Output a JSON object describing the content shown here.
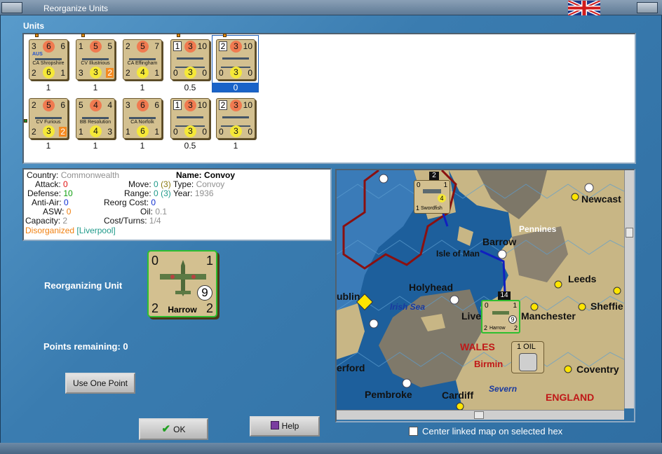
{
  "window": {
    "title": "Reorganize Units"
  },
  "units": {
    "label": "Units",
    "row1": [
      {
        "name": "CA Shropshire",
        "tl": "3",
        "tm": "6",
        "tr": "6",
        "bl": "2",
        "bm": "6",
        "br": "1",
        "sub": "AUS",
        "value": "1"
      },
      {
        "name": "CV Illustrious",
        "tl": "1",
        "tm": "5",
        "tr": "5",
        "bl": "3",
        "bm": "3",
        "br": "2",
        "value": "1"
      },
      {
        "name": "CA Effingham",
        "tl": "2",
        "tm": "5",
        "tr": "7",
        "bl": "2",
        "bm": "4",
        "br": "1",
        "value": "1"
      },
      {
        "name": "",
        "tl": "1",
        "tm": "3",
        "tr": "10",
        "bl": "0",
        "bm": "3",
        "br": "0",
        "value": "0.5"
      },
      {
        "name": "",
        "tl": "2",
        "tm": "3",
        "tr": "10",
        "bl": "0",
        "bm": "3",
        "br": "0",
        "value": "0"
      }
    ],
    "row2": [
      {
        "name": "CV Furious",
        "tl": "2",
        "tm": "5",
        "tr": "6",
        "bl": "2",
        "bm": "3",
        "br": "2",
        "value": "1"
      },
      {
        "name": "BB Resolution",
        "tl": "5",
        "tm": "4",
        "tr": "4",
        "bl": "1",
        "bm": "4",
        "br": "3",
        "value": "1"
      },
      {
        "name": "CA Norfolk",
        "tl": "3",
        "tm": "6",
        "tr": "6",
        "bl": "1",
        "bm": "6",
        "br": "1",
        "value": "1"
      },
      {
        "name": "",
        "tl": "1",
        "tm": "3",
        "tr": "10",
        "bl": "0",
        "bm": "3",
        "br": "0",
        "value": "0.5"
      },
      {
        "name": "",
        "tl": "2",
        "tm": "3",
        "tr": "10",
        "bl": "0",
        "bm": "3",
        "br": "0",
        "value": "1"
      }
    ]
  },
  "info": {
    "country_label": "Country:",
    "country": "Commonwealth",
    "attack_label": "Attack:",
    "attack": "0",
    "defense_label": "Defense:",
    "defense": "10",
    "antiair_label": "Anti-Air:",
    "antiair": "0",
    "asw_label": "ASW:",
    "asw": "0",
    "capacity_label": "Capacity:",
    "capacity": "2",
    "status": "Disorganized",
    "location": "[Liverpool]",
    "name_label": "Name:",
    "name": "Convoy",
    "move_label": "Move:",
    "move": "0",
    "move_extra": "(3)",
    "type_label": "Type:",
    "type": "Convoy",
    "range_label": "Range:",
    "range": "0",
    "range_extra": "(3)",
    "year_label": "Year:",
    "year": "1936",
    "reorg_label": "Reorg Cost:",
    "reorg": "0",
    "oil_label": "Oil:",
    "oil": "0.1",
    "cost_label": "Cost/Turns:",
    "cost": "1/4"
  },
  "reorg": {
    "unit_label": "Reorganizing Unit",
    "points_label": "Points remaining:",
    "points": "0",
    "counter": {
      "tl": "0",
      "tr": "1",
      "bl": "2",
      "br": "2",
      "strength": "9",
      "name": "Harrow"
    }
  },
  "buttons": {
    "use_point": "Use One Point",
    "ok": "OK",
    "help": "Help"
  },
  "map": {
    "labels": {
      "newcastle": "Newcast",
      "pennines": "Pennines",
      "barrow": "Barrow",
      "isle_of_man": "Isle of Man",
      "leeds": "Leeds",
      "holyhead": "Holyhead",
      "dublin": "ublin",
      "irish_sea": "Irish Sea",
      "liverpool": "Liver",
      "manchester": "Manchester",
      "sheffield": "Sheffie",
      "wales": "WALES",
      "birmingham": "Birmin",
      "oil": "1 OIL",
      "hereford": "erford",
      "coventry": "Coventry",
      "pembroke": "Pembroke",
      "cardiff": "Cardiff",
      "severn": "Severn",
      "england": "ENGLAND"
    },
    "stack_swordfish": {
      "count": "2",
      "tl": "0",
      "tr": "1",
      "bl": "1",
      "strength": "4",
      "name": "Swordfish"
    },
    "stack_harrow": {
      "count": "14",
      "tl": "0",
      "tr": "1",
      "bl": "2",
      "br": "2",
      "strength": "9",
      "name": "Harrow"
    },
    "center_label": "Center linked map on selected hex"
  }
}
